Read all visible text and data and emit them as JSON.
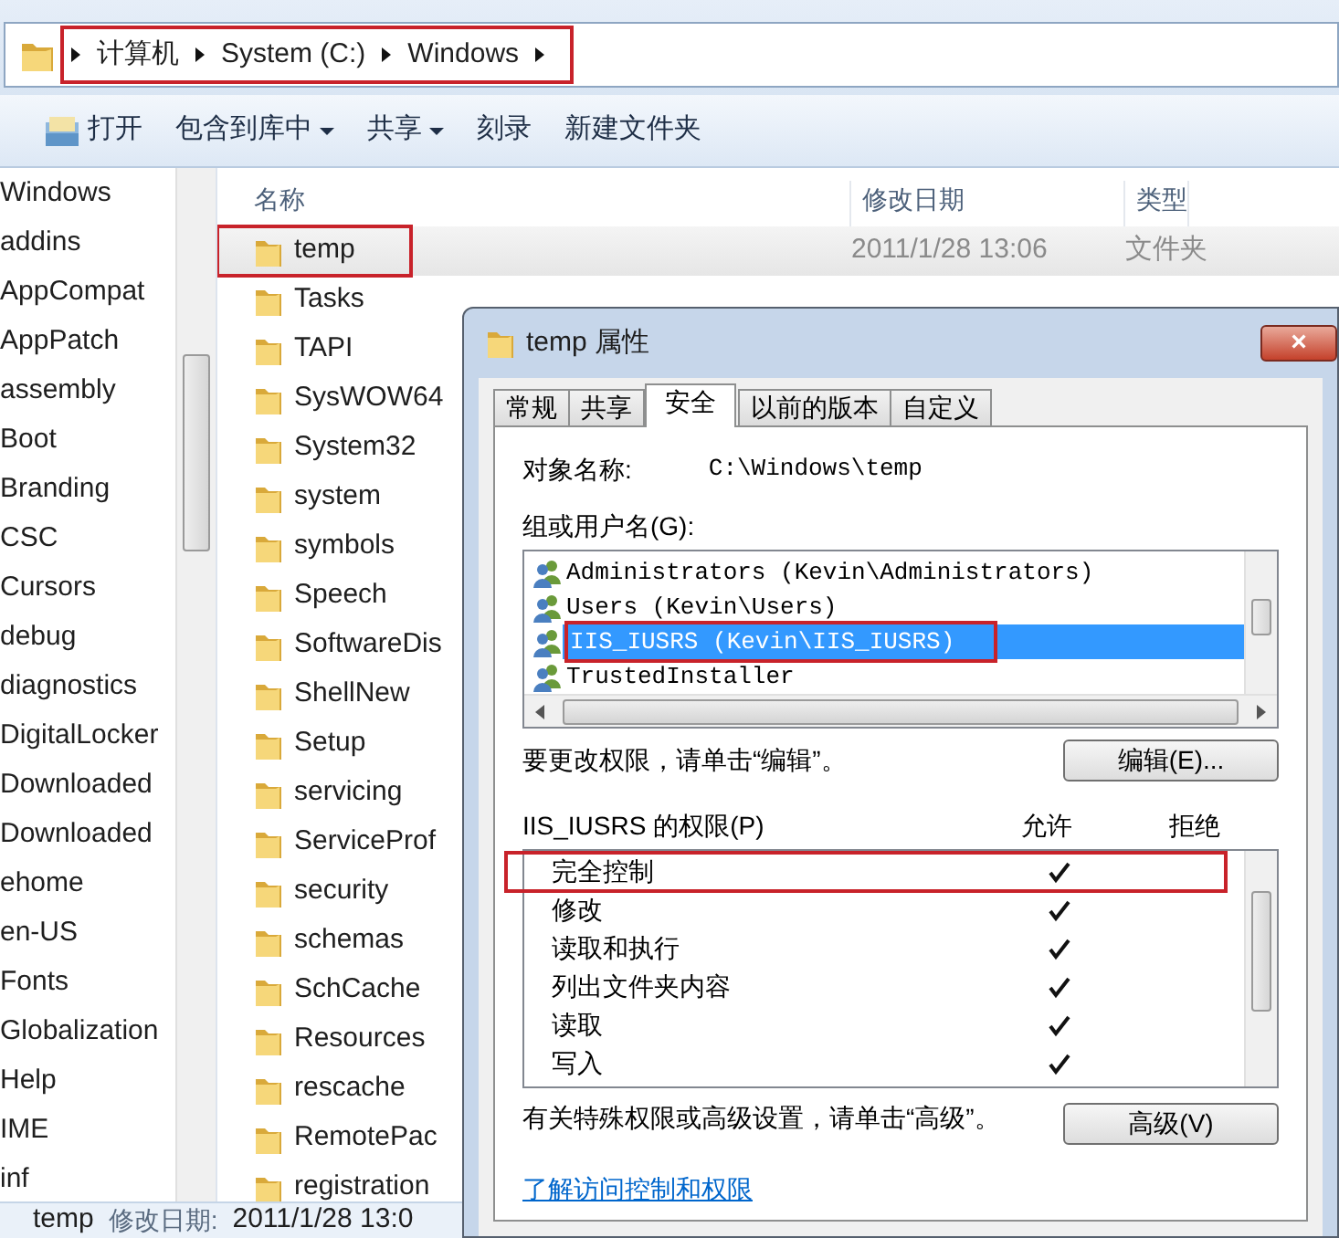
{
  "address_bar": {
    "crumbs": [
      "计算机",
      "System (C:)",
      "Windows"
    ],
    "highlighted": true
  },
  "toolbar": [
    {
      "label": "打开",
      "kind": "icon"
    },
    {
      "label": "包含到库中",
      "kind": "menu"
    },
    {
      "label": "共享",
      "kind": "menu"
    },
    {
      "label": "刻录",
      "kind": "plain"
    },
    {
      "label": "新建文件夹",
      "kind": "plain"
    }
  ],
  "sidebar": {
    "items": [
      "Windows",
      "addins",
      "AppCompat",
      "AppPatch",
      "assembly",
      "Boot",
      "Branding",
      "CSC",
      "Cursors",
      "debug",
      "diagnostics",
      "DigitalLocker",
      "Downloaded",
      "Downloaded",
      "ehome",
      "en-US",
      "Fonts",
      "Globalization",
      "Help",
      "IME",
      "inf"
    ]
  },
  "file_list": {
    "columns": [
      "名称",
      "修改日期",
      "类型"
    ],
    "rows": [
      {
        "name": "temp",
        "date": "2011/1/28 13:06",
        "type": "文件夹",
        "selected": true,
        "highlighted": true
      },
      {
        "name": "Tasks",
        "selected": false,
        "highlighted": false
      },
      {
        "name": "TAPI",
        "selected": false,
        "highlighted": false
      },
      {
        "name": "SysWOW64",
        "selected": false,
        "highlighted": false
      },
      {
        "name": "System32",
        "selected": false,
        "highlighted": false
      },
      {
        "name": "system",
        "selected": false,
        "highlighted": false
      },
      {
        "name": "symbols",
        "selected": false,
        "highlighted": false
      },
      {
        "name": "Speech",
        "selected": false,
        "highlighted": false
      },
      {
        "name": "SoftwareDis",
        "selected": false,
        "highlighted": false
      },
      {
        "name": "ShellNew",
        "selected": false,
        "highlighted": false
      },
      {
        "name": "Setup",
        "selected": false,
        "highlighted": false
      },
      {
        "name": "servicing",
        "selected": false,
        "highlighted": false
      },
      {
        "name": "ServiceProf",
        "selected": false,
        "highlighted": false
      },
      {
        "name": "security",
        "selected": false,
        "highlighted": false
      },
      {
        "name": "schemas",
        "selected": false,
        "highlighted": false
      },
      {
        "name": "SchCache",
        "selected": false,
        "highlighted": false
      },
      {
        "name": "Resources",
        "selected": false,
        "highlighted": false
      },
      {
        "name": "rescache",
        "selected": false,
        "highlighted": false
      },
      {
        "name": "RemotePac",
        "selected": false,
        "highlighted": false
      },
      {
        "name": "registration",
        "selected": false,
        "highlighted": false
      }
    ]
  },
  "status_bar": {
    "name": "temp",
    "label": "修改日期:",
    "value": "2011/1/28 13:0"
  },
  "dialog": {
    "title": "temp 属性",
    "close": "×",
    "tabs": [
      {
        "label": "常规",
        "selected": false
      },
      {
        "label": "共享",
        "selected": false
      },
      {
        "label": "安全",
        "selected": true
      },
      {
        "label": "以前的版本",
        "selected": false
      },
      {
        "label": "自定义",
        "selected": false
      }
    ],
    "object_label": "对象名称:",
    "object_value": "C:\\Windows\\temp",
    "groups_label": "组或用户名(G):",
    "users": [
      {
        "name": "Administrators (Kevin\\Administrators)",
        "selected": false,
        "highlighted": false
      },
      {
        "name": "Users (Kevin\\Users)",
        "selected": false,
        "highlighted": false
      },
      {
        "name": "IIS_IUSRS (Kevin\\IIS_IUSRS)",
        "selected": true,
        "highlighted": true
      },
      {
        "name": "TrustedInstaller",
        "selected": false,
        "highlighted": false
      }
    ],
    "edit_hint": "要更改权限，请单击“编辑”。",
    "edit_button": "编辑(E)...",
    "permissions_label": "IIS_IUSRS 的权限(P)",
    "allow_label": "允许",
    "deny_label": "拒绝",
    "permissions": [
      {
        "name": "完全控制",
        "allow": true,
        "deny": false,
        "highlighted": true
      },
      {
        "name": "修改",
        "allow": true,
        "deny": false,
        "highlighted": false
      },
      {
        "name": "读取和执行",
        "allow": true,
        "deny": false,
        "highlighted": false
      },
      {
        "name": "列出文件夹内容",
        "allow": true,
        "deny": false,
        "highlighted": false
      },
      {
        "name": "读取",
        "allow": true,
        "deny": false,
        "highlighted": false
      },
      {
        "name": "写入",
        "allow": true,
        "deny": false,
        "highlighted": false
      }
    ],
    "advanced_hint": "有关特殊权限或高级设置，请单击“高级”。",
    "advanced_button": "高级(V)",
    "link": "了解访问控制和权限"
  }
}
